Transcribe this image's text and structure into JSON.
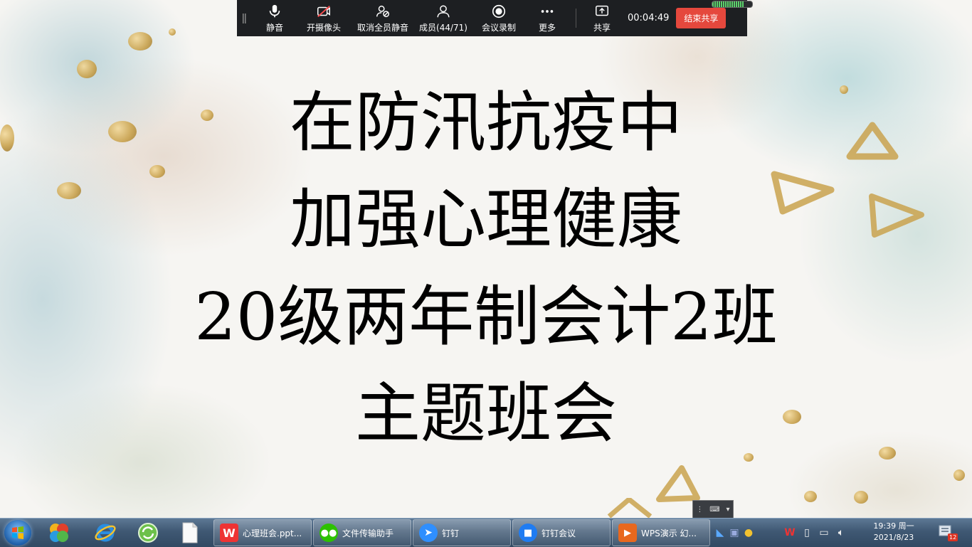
{
  "slide": {
    "title_lines": [
      "在防汛抗疫中",
      "加强心理健康",
      "20级两年制会计2班",
      "主题班会"
    ]
  },
  "meeting_toolbar": {
    "buttons": [
      {
        "icon": "microphone-icon",
        "label": "静音"
      },
      {
        "icon": "camera-off-icon",
        "label": "开摄像头"
      },
      {
        "icon": "unmute-all-icon",
        "label": "取消全员静音"
      },
      {
        "icon": "members-icon",
        "label": "成员(44/71)"
      },
      {
        "icon": "record-icon",
        "label": "会议录制"
      },
      {
        "icon": "more-icon",
        "label": "更多"
      },
      {
        "icon": "share-icon",
        "label": "共享"
      }
    ],
    "timer": "00:04:49",
    "end_share_label": "结束共享",
    "end_share_color": "#e5483d"
  },
  "taskbar": {
    "tasks": [
      {
        "icon": "wps-writer-icon",
        "label": "心理班会.ppt..."
      },
      {
        "icon": "wechat-icon",
        "label": "文件传输助手"
      },
      {
        "icon": "dingtalk-icon",
        "label": "钉钉"
      },
      {
        "icon": "dingtalk-meeting-icon",
        "label": "钉钉会议"
      },
      {
        "icon": "wps-presentation-icon",
        "label": "WPS演示 幻..."
      }
    ],
    "clock": {
      "time": "19:39 周一",
      "date": "2021/8/23"
    },
    "notification_count": "12"
  }
}
